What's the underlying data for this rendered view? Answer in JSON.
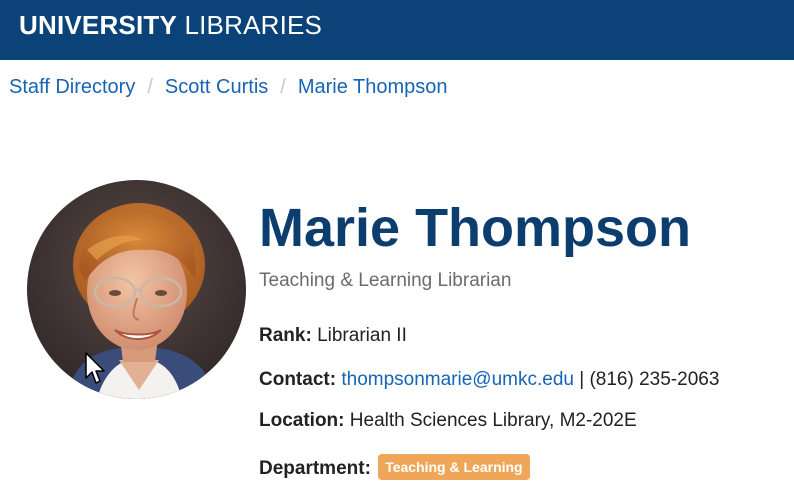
{
  "header": {
    "brand_bold": "UNIVERSITY",
    "brand_light": "LIBRARIES",
    "background_color": "#0b4277"
  },
  "breadcrumb": {
    "items": [
      "Staff Directory",
      "Scott Curtis",
      "Marie Thompson"
    ],
    "separator": "/"
  },
  "profile": {
    "name": "Marie Thompson",
    "title": "Teaching & Learning Librarian",
    "rank_label": "Rank:",
    "rank": "Librarian II",
    "contact_label": "Contact:",
    "email": "thompsonmarie@umkc.edu",
    "contact_separator": "|",
    "phone": "(816) 235-2063",
    "location_label": "Location:",
    "location": "Health Sciences Library, M2-202E",
    "department_label": "Department:",
    "department": "Teaching & Learning",
    "department_badge_color": "#f0a659",
    "name_color": "#0b3d6e",
    "link_color": "#1764b5"
  },
  "icons": {
    "cursor": "mouse-pointer-icon",
    "photo": "portrait-photo"
  }
}
